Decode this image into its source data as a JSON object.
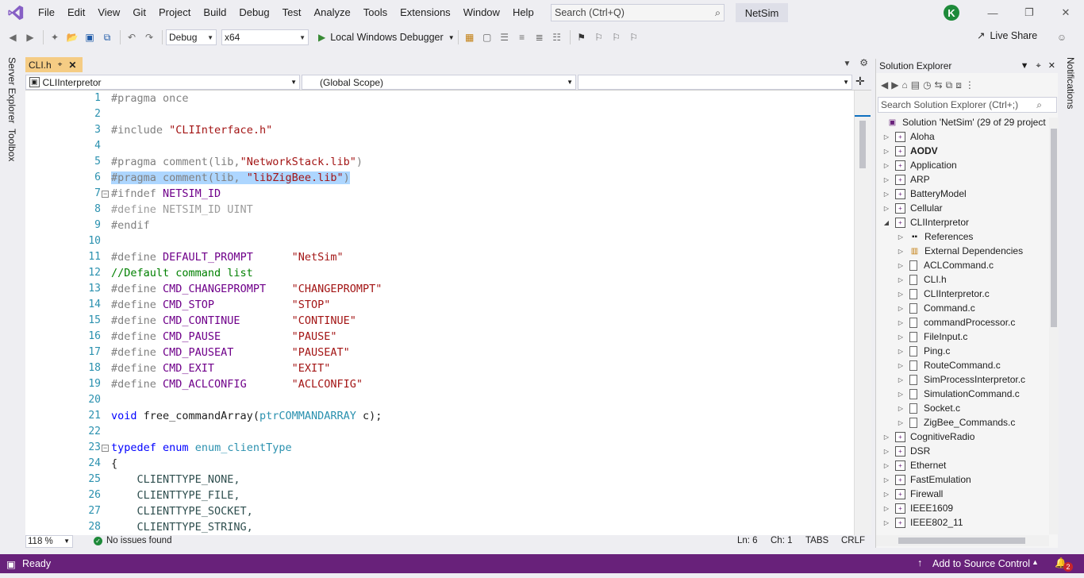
{
  "menu": [
    "File",
    "Edit",
    "View",
    "Git",
    "Project",
    "Build",
    "Debug",
    "Test",
    "Analyze",
    "Tools",
    "Extensions",
    "Window",
    "Help"
  ],
  "search": {
    "placeholder": "Search (Ctrl+Q)"
  },
  "solution_name": "NetSim",
  "user_initial": "K",
  "toolbar": {
    "config": "Debug",
    "platform": "x64",
    "run_label": "Local Windows Debugger",
    "live_share": "Live Share"
  },
  "left_tabs": [
    "Server Explorer",
    "Toolbox"
  ],
  "right_tabs": [
    "Notifications"
  ],
  "editor": {
    "tab_label": "CLI.h",
    "nav_project": "CLIInterpretor",
    "nav_scope": "(Global Scope)",
    "nav_member": ""
  },
  "editor_status": {
    "zoom": "118 %",
    "issues": "No issues found",
    "line": "Ln: 6",
    "col": "Ch: 1",
    "indent": "TABS",
    "eol": "CRLF"
  },
  "code_lines": [
    {
      "n": "1"
    },
    {
      "n": "2"
    },
    {
      "n": "3"
    },
    {
      "n": "4"
    },
    {
      "n": "5"
    },
    {
      "n": "6"
    },
    {
      "n": "7"
    },
    {
      "n": "8"
    },
    {
      "n": "9"
    },
    {
      "n": "10"
    },
    {
      "n": "11"
    },
    {
      "n": "12"
    },
    {
      "n": "13"
    },
    {
      "n": "14"
    },
    {
      "n": "15"
    },
    {
      "n": "16"
    },
    {
      "n": "17"
    },
    {
      "n": "18"
    },
    {
      "n": "19"
    },
    {
      "n": "20"
    },
    {
      "n": "21"
    },
    {
      "n": "22"
    },
    {
      "n": "23"
    },
    {
      "n": "24"
    },
    {
      "n": "25"
    },
    {
      "n": "26"
    },
    {
      "n": "27"
    },
    {
      "n": "28"
    }
  ],
  "code": {
    "l1": [
      "#pragma once"
    ],
    "l3": [
      "#include ",
      "\"CLIInterface.h\""
    ],
    "l5": [
      "#pragma comment(lib,",
      "\"NetworkStack.lib\"",
      ")"
    ],
    "l6": [
      "#pragma comment(lib, ",
      "\"libZigBee.lib\"",
      ")"
    ],
    "l7": [
      "#ifndef ",
      "NETSIM_ID"
    ],
    "l8": [
      "#define NETSIM_ID UINT"
    ],
    "l9": [
      "#endif"
    ],
    "l11": [
      "#define ",
      "DEFAULT_PROMPT",
      "      ",
      "\"NetSim\""
    ],
    "l12": [
      "//Default command list"
    ],
    "l13": [
      "#define ",
      "CMD_CHANGEPROMPT",
      "    ",
      "\"CHANGEPROMPT\""
    ],
    "l14": [
      "#define ",
      "CMD_STOP",
      "            ",
      "\"STOP\""
    ],
    "l15": [
      "#define ",
      "CMD_CONTINUE",
      "        ",
      "\"CONTINUE\""
    ],
    "l16": [
      "#define ",
      "CMD_PAUSE",
      "           ",
      "\"PAUSE\""
    ],
    "l17": [
      "#define ",
      "CMD_PAUSEAT",
      "         ",
      "\"PAUSEAT\""
    ],
    "l18": [
      "#define ",
      "CMD_EXIT",
      "            ",
      "\"EXIT\""
    ],
    "l19": [
      "#define ",
      "CMD_ACLCONFIG",
      "       ",
      "\"ACLCONFIG\""
    ],
    "l21": [
      "void",
      " free_commandArray(",
      "ptrCOMMANDARRAY",
      " c);"
    ],
    "l23": [
      "typedef",
      " ",
      "enum",
      " ",
      "enum_clientType"
    ],
    "l24": [
      "{"
    ],
    "l25": [
      "    CLIENTTYPE_NONE,"
    ],
    "l26": [
      "    CLIENTTYPE_FILE,"
    ],
    "l27": [
      "    CLIENTTYPE_SOCKET,"
    ],
    "l28": [
      "    CLIENTTYPE_STRING,"
    ]
  },
  "solution_explorer": {
    "title": "Solution Explorer",
    "search_placeholder": "Search Solution Explorer (Ctrl+;)",
    "root": "Solution 'NetSim' (29 of 29 project",
    "items": [
      {
        "label": "Aloha",
        "kind": "project",
        "level": 1,
        "state": "collapsed"
      },
      {
        "label": "AODV",
        "kind": "project",
        "level": 1,
        "state": "collapsed",
        "bold": true
      },
      {
        "label": "Application",
        "kind": "project",
        "level": 1,
        "state": "collapsed"
      },
      {
        "label": "ARP",
        "kind": "project",
        "level": 1,
        "state": "collapsed"
      },
      {
        "label": "BatteryModel",
        "kind": "project",
        "level": 1,
        "state": "collapsed"
      },
      {
        "label": "Cellular",
        "kind": "project",
        "level": 1,
        "state": "collapsed"
      },
      {
        "label": "CLIInterpretor",
        "kind": "project",
        "level": 1,
        "state": "expanded"
      },
      {
        "label": "References",
        "kind": "refs",
        "level": 2,
        "state": "collapsed"
      },
      {
        "label": "External Dependencies",
        "kind": "folder",
        "level": 2,
        "state": "collapsed"
      },
      {
        "label": "ACLCommand.c",
        "kind": "file",
        "level": 2,
        "state": "collapsed"
      },
      {
        "label": "CLI.h",
        "kind": "file",
        "level": 2,
        "state": "collapsed"
      },
      {
        "label": "CLIInterpretor.c",
        "kind": "file",
        "level": 2,
        "state": "collapsed"
      },
      {
        "label": "Command.c",
        "kind": "file",
        "level": 2,
        "state": "collapsed"
      },
      {
        "label": "commandProcessor.c",
        "kind": "file",
        "level": 2,
        "state": "collapsed"
      },
      {
        "label": "FileInput.c",
        "kind": "file",
        "level": 2,
        "state": "collapsed"
      },
      {
        "label": "Ping.c",
        "kind": "file",
        "level": 2,
        "state": "collapsed"
      },
      {
        "label": "RouteCommand.c",
        "kind": "file",
        "level": 2,
        "state": "collapsed"
      },
      {
        "label": "SimProcessInterpretor.c",
        "kind": "file",
        "level": 2,
        "state": "collapsed"
      },
      {
        "label": "SimulationCommand.c",
        "kind": "file",
        "level": 2,
        "state": "collapsed"
      },
      {
        "label": "Socket.c",
        "kind": "file",
        "level": 2,
        "state": "collapsed"
      },
      {
        "label": "ZigBee_Commands.c",
        "kind": "file",
        "level": 2,
        "state": "collapsed"
      },
      {
        "label": "CognitiveRadio",
        "kind": "project",
        "level": 1,
        "state": "collapsed"
      },
      {
        "label": "DSR",
        "kind": "project",
        "level": 1,
        "state": "collapsed"
      },
      {
        "label": "Ethernet",
        "kind": "project",
        "level": 1,
        "state": "collapsed"
      },
      {
        "label": "FastEmulation",
        "kind": "project",
        "level": 1,
        "state": "collapsed"
      },
      {
        "label": "Firewall",
        "kind": "project",
        "level": 1,
        "state": "collapsed"
      },
      {
        "label": "IEEE1609",
        "kind": "project",
        "level": 1,
        "state": "collapsed"
      },
      {
        "label": "IEEE802_11",
        "kind": "project",
        "level": 1,
        "state": "collapsed"
      }
    ]
  },
  "statusbar": {
    "ready": "Ready",
    "source_control": "Add to Source Control",
    "notifications_count": "2"
  },
  "colors": {
    "statusbar": "#68217a",
    "active_tab": "#f5cc84",
    "selection": "#add6ff",
    "line_numbers": "#2b91af"
  }
}
